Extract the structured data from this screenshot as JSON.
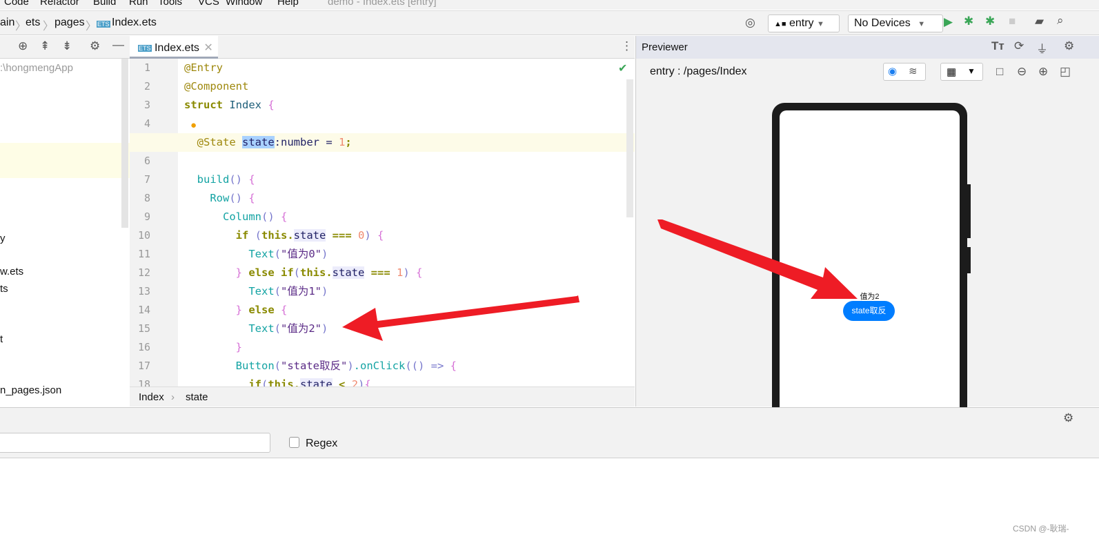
{
  "menu": [
    "Code",
    "Refactor",
    "Build",
    "Run",
    "Tools",
    "VCS",
    "Window",
    "Help"
  ],
  "window_title": "demo - Index.ets [entry]",
  "breadcrumb": [
    "ain",
    "ets",
    "pages",
    "Index.ets"
  ],
  "run_config": "entry",
  "device": "No Devices",
  "editor_tab": "Index.ets",
  "project_root": ":\\hongmengApp",
  "tree_items": [
    "y",
    "w.ets",
    "ts",
    "t",
    "n_pages.json"
  ],
  "code_lines": [
    [
      [
        "@Entry",
        "dec"
      ]
    ],
    [
      [
        "@Component",
        "dec"
      ]
    ],
    [
      [
        "struct ",
        "kw"
      ],
      [
        "Index ",
        "id"
      ],
      [
        "{",
        "br"
      ]
    ],
    [
      [
        "",
        ""
      ]
    ],
    [
      [
        "  ",
        ""
      ],
      [
        "@State ",
        "dec"
      ],
      [
        "state",
        "pl sel"
      ],
      [
        ":number = ",
        "pl"
      ],
      [
        "1",
        "num"
      ],
      [
        ";",
        "kw"
      ]
    ],
    [
      [
        "",
        ""
      ]
    ],
    [
      [
        "  ",
        ""
      ],
      [
        "build",
        "fn"
      ],
      [
        "()",
        "pr"
      ],
      [
        " {",
        "br"
      ]
    ],
    [
      [
        "    ",
        ""
      ],
      [
        "Row",
        "fn"
      ],
      [
        "()",
        "pr"
      ],
      [
        " {",
        "br"
      ]
    ],
    [
      [
        "      ",
        ""
      ],
      [
        "Column",
        "fn"
      ],
      [
        "()",
        "pr"
      ],
      [
        " {",
        "br"
      ]
    ],
    [
      [
        "        ",
        ""
      ],
      [
        "if ",
        "kw"
      ],
      [
        "(",
        "pr"
      ],
      [
        "this.",
        "kw"
      ],
      [
        "state",
        "pl use"
      ],
      [
        " === ",
        "kw"
      ],
      [
        "0",
        "num"
      ],
      [
        ") ",
        "pr"
      ],
      [
        "{",
        "br"
      ]
    ],
    [
      [
        "          ",
        ""
      ],
      [
        "Text",
        "fn"
      ],
      [
        "(",
        "pr"
      ],
      [
        "\"值为0\"",
        "str"
      ],
      [
        ")",
        "pr"
      ]
    ],
    [
      [
        "        ",
        ""
      ],
      [
        "} ",
        "br"
      ],
      [
        "else if",
        "kw"
      ],
      [
        "(",
        "pr"
      ],
      [
        "this.",
        "kw"
      ],
      [
        "state",
        "pl use"
      ],
      [
        " === ",
        "kw"
      ],
      [
        "1",
        "num"
      ],
      [
        ") ",
        "pr"
      ],
      [
        "{",
        "br"
      ]
    ],
    [
      [
        "          ",
        ""
      ],
      [
        "Text",
        "fn"
      ],
      [
        "(",
        "pr"
      ],
      [
        "\"值为1\"",
        "str"
      ],
      [
        ")",
        "pr"
      ]
    ],
    [
      [
        "        ",
        ""
      ],
      [
        "} ",
        "br"
      ],
      [
        "else ",
        "kw"
      ],
      [
        "{",
        "br"
      ]
    ],
    [
      [
        "          ",
        ""
      ],
      [
        "Text",
        "fn"
      ],
      [
        "(",
        "pr"
      ],
      [
        "\"值为2\"",
        "str"
      ],
      [
        ")",
        "pr"
      ]
    ],
    [
      [
        "        ",
        ""
      ],
      [
        "}",
        "br"
      ]
    ],
    [
      [
        "        ",
        ""
      ],
      [
        "Button",
        "fn"
      ],
      [
        "(",
        "pr"
      ],
      [
        "\"state取反\"",
        "str"
      ],
      [
        ")",
        "pr"
      ],
      [
        ".onClick",
        "fn"
      ],
      [
        "(() => ",
        "pr"
      ],
      [
        "{",
        "br"
      ]
    ],
    [
      [
        "          ",
        ""
      ],
      [
        "if",
        "kw"
      ],
      [
        "(",
        "pr"
      ],
      [
        "this.",
        "kw"
      ],
      [
        "state",
        "pl use"
      ],
      [
        " < ",
        "kw"
      ],
      [
        "2",
        "num"
      ],
      [
        ")",
        "pr"
      ],
      [
        "{",
        "br"
      ]
    ]
  ],
  "footer_crumb": [
    "Index",
    "state"
  ],
  "previewer": {
    "title": "Previewer",
    "path": "entry : /pages/Index",
    "text": "值为2",
    "button": "state取反",
    "accent": "#007dff"
  },
  "search": {
    "value": "",
    "regex_label": "Regex",
    "regex_checked": false
  },
  "watermark": "CSDN @-耿瑞-",
  "annotation_color": "#ee1c25"
}
